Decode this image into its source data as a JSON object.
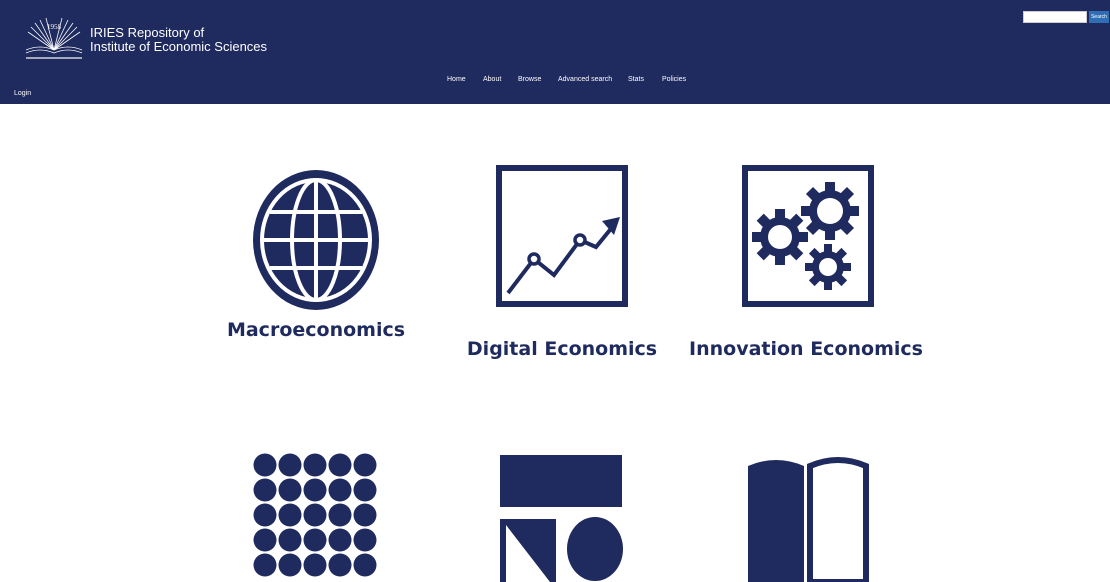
{
  "header": {
    "title_line1": "IRIES Repository of",
    "title_line2": "Institute of Economic Sciences",
    "logo_icon": "open-book-sunburst-logo",
    "logo_year": "1958"
  },
  "search": {
    "value": "",
    "button_label": "Search"
  },
  "nav": {
    "items": [
      {
        "label": "Home"
      },
      {
        "label": "About"
      },
      {
        "label": "Browse"
      },
      {
        "label": "Advanced search"
      },
      {
        "label": "Stats"
      },
      {
        "label": "Policies"
      }
    ]
  },
  "login_label": "Login",
  "colors": {
    "brand": "#1f2a5e",
    "search_button": "#2f6eb5"
  },
  "tiles": [
    {
      "label": "Macroeconomics",
      "icon": "globe-icon"
    },
    {
      "label": "Digital Economics",
      "icon": "growth-chart-icon"
    },
    {
      "label": "Innovation Economics",
      "icon": "gears-icon"
    },
    {
      "label": "",
      "icon": "dot-grid-icon"
    },
    {
      "label": "",
      "icon": "shapes-icon"
    },
    {
      "label": "",
      "icon": "open-book-icon"
    }
  ]
}
